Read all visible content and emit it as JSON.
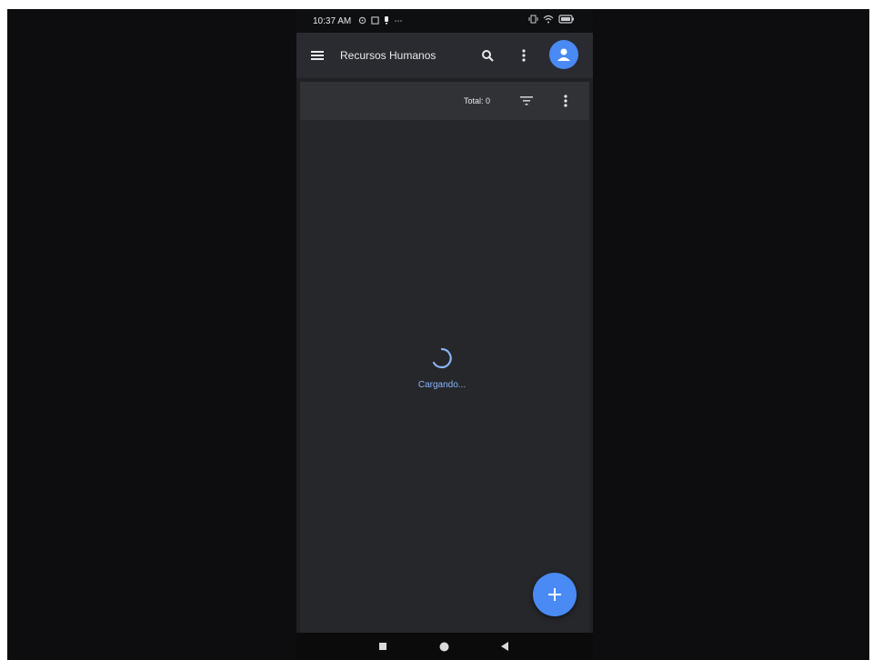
{
  "status_bar": {
    "time": "10:37 AM",
    "left_icons": [
      "location-icon",
      "screenshot-icon",
      "notification-icon",
      "more-notifications-icon"
    ],
    "right_icons": [
      "vibrate-icon",
      "wifi-icon",
      "battery-icon"
    ]
  },
  "app_bar": {
    "title": "Recursos Humanos",
    "icons": [
      "menu-icon",
      "search-icon",
      "more-vert-icon",
      "avatar"
    ]
  },
  "toolbar": {
    "total_label": "Total: 0",
    "icons": [
      "filter-icon",
      "more-vert-icon"
    ]
  },
  "main": {
    "loading_text": "Cargando..."
  },
  "fab": {
    "icon": "plus-icon"
  },
  "nav_bar": {
    "icons": [
      "recents-icon",
      "home-icon",
      "back-icon"
    ]
  },
  "colors": {
    "accent": "#4a8af4",
    "background": "#202124",
    "app_bar": "#292b30",
    "loading_text": "#8ab4f8"
  }
}
